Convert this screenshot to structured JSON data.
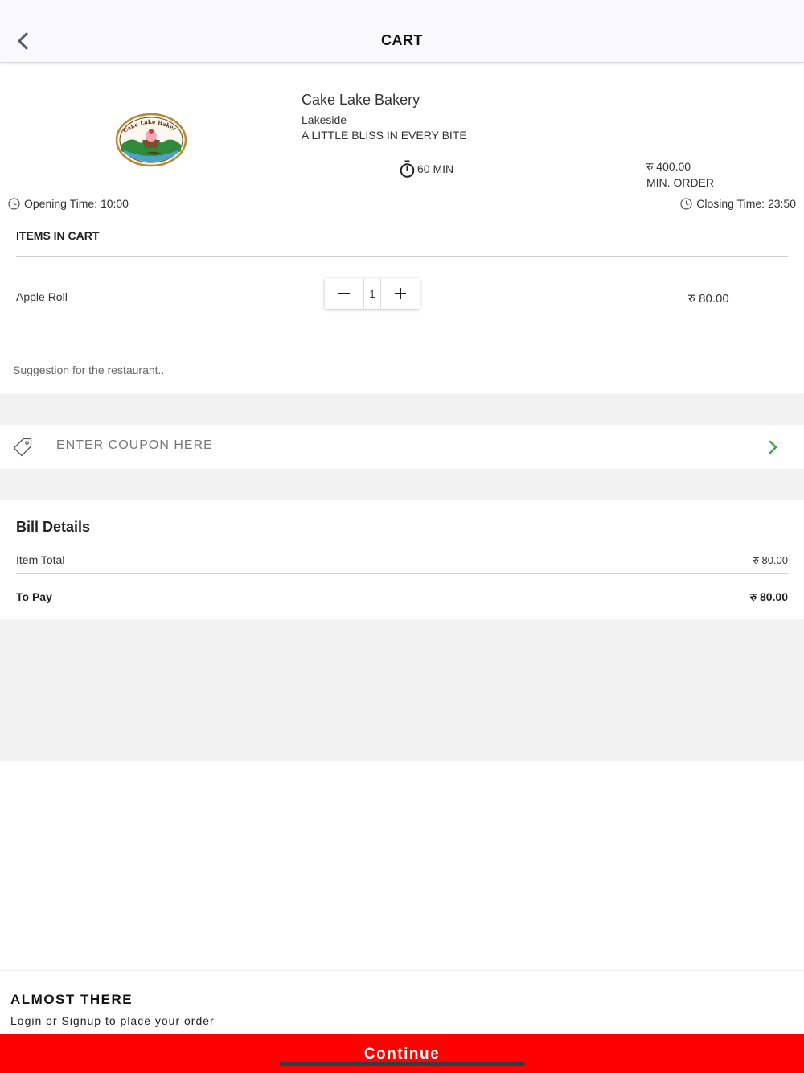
{
  "header": {
    "title": "CART"
  },
  "restaurant": {
    "name": "Cake Lake Bakery",
    "location": "Lakeside",
    "tagline": "A LITTLE BLISS IN EVERY BITE",
    "logo_text": "Cake Lake Bakery",
    "eta": "60 MIN",
    "min_order_value": "रु 400.00",
    "min_order_label": "MIN. ORDER",
    "opening_time": "Opening Time: 10:00",
    "closing_time": "Closing Time: 23:50"
  },
  "cart": {
    "title": "ITEMS IN CART",
    "items": [
      {
        "name": "Apple Roll",
        "quantity": "1",
        "price": "रु 80.00"
      }
    ],
    "suggestion_placeholder": "Suggestion for the restaurant.."
  },
  "coupon": {
    "placeholder": "ENTER COUPON HERE"
  },
  "bill": {
    "title": "Bill Details",
    "item_total_label": "Item Total",
    "item_total_value": "रु 80.00",
    "to_pay_label": "To Pay",
    "to_pay_value": "रु 80.00"
  },
  "footer": {
    "title": "ALMOST THERE",
    "subtitle": "Login or Signup to place your order",
    "continue_label": "Continue"
  },
  "colors": {
    "accent": "#ff0000",
    "coupon_arrow": "#3aa84a",
    "header_icon": "#4a5a6a"
  },
  "icons": {
    "back": "chevron-left-icon",
    "timer": "stopwatch-icon",
    "clock": "clock-icon",
    "coupon": "tag-icon",
    "apply": "chevron-right-icon"
  }
}
